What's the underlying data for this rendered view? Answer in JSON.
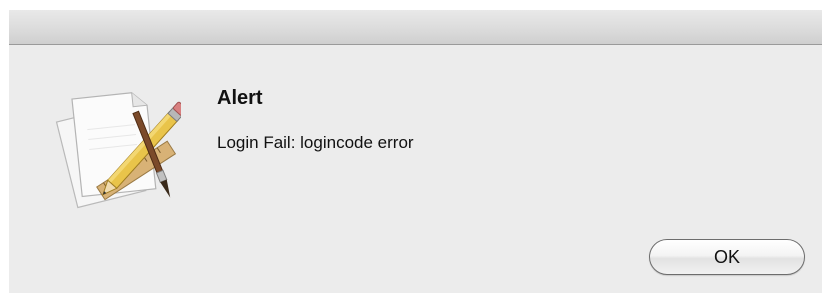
{
  "dialog": {
    "icon": "script-editor-pencil-ruler-icon",
    "title": "Alert",
    "message": "Login Fail: logincode error",
    "buttons": {
      "ok_label": "OK"
    }
  },
  "colors": {
    "background": "#ececec",
    "text": "#111111",
    "button_border": "#6d6d6d"
  }
}
